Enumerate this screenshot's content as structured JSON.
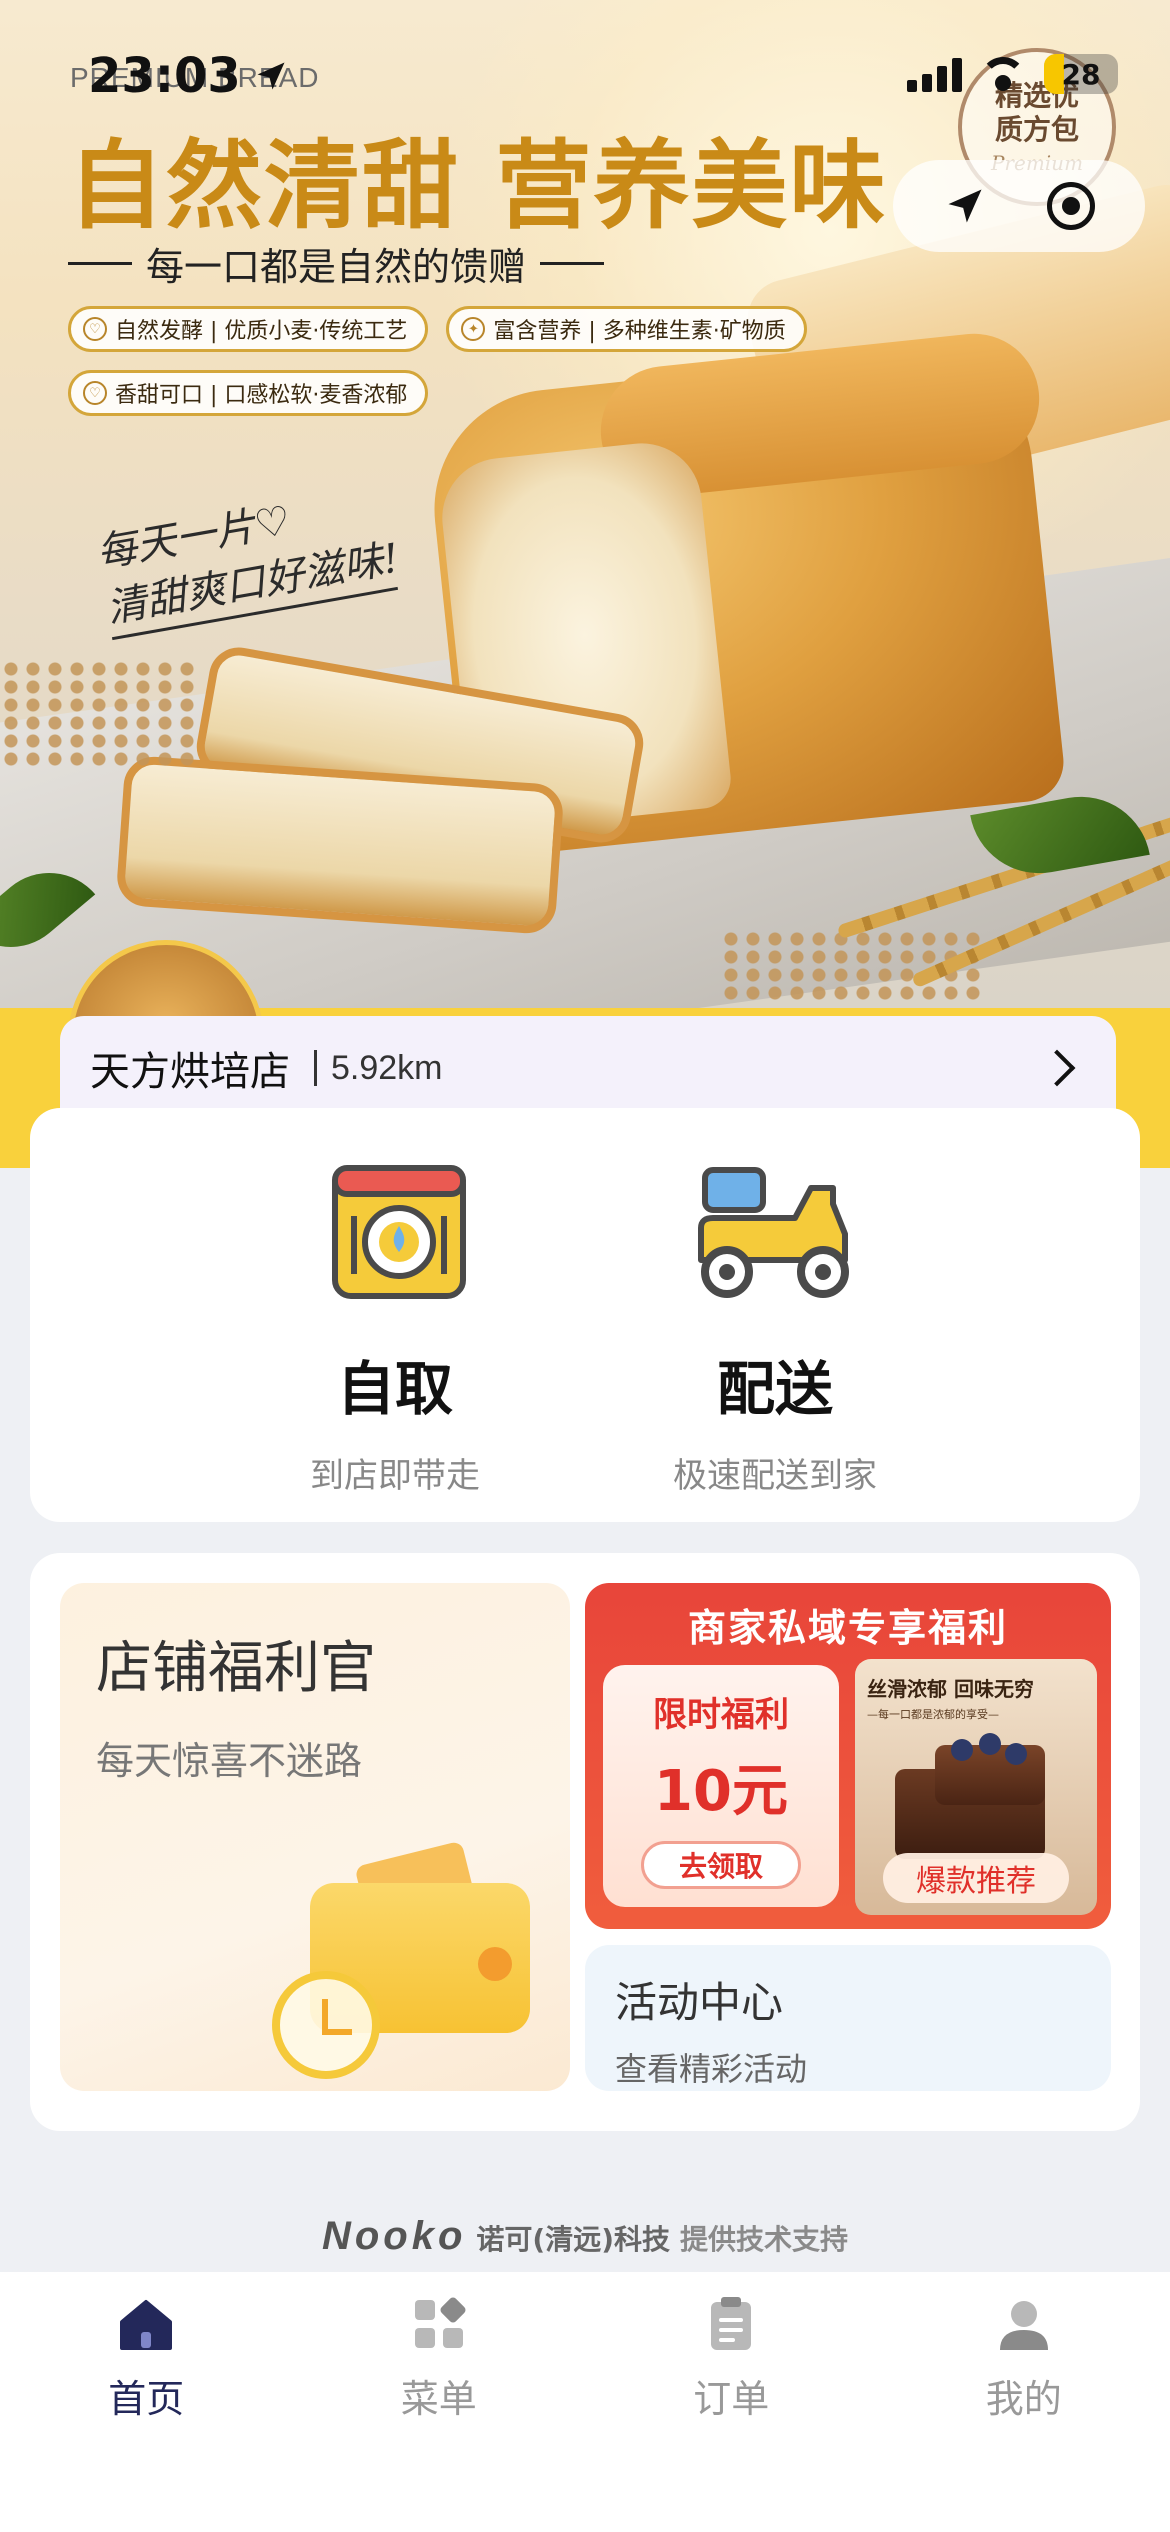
{
  "status_bar": {
    "time": "23:03",
    "battery": "28"
  },
  "banner": {
    "brand": "PREMIUM BREAD",
    "headline": "自然清甜 营养美味",
    "subline": "每一口都是自然的馈赠",
    "tags": [
      "自然发酵 | 优质小麦·传统工艺",
      "富含营养 | 多种维生素·矿物质",
      "香甜可口 | 口感松软·麦香浓郁"
    ],
    "handwriting_line1": "每天一片♡",
    "handwriting_line2": "清甜爽口好滋味!",
    "badge_text": "精选优质方包",
    "badge_sub": "Premium"
  },
  "store": {
    "name": "天方烘培店",
    "distance": "5.92km"
  },
  "modes": [
    {
      "title": "自取",
      "subtitle": "到店即带走",
      "icon": "dining-plate-icon"
    },
    {
      "title": "配送",
      "subtitle": "极速配送到家",
      "icon": "delivery-scooter-icon"
    }
  ],
  "promos": {
    "welfare_title": "店铺福利官",
    "welfare_sub": "每天惊喜不迷路",
    "merchant_title": "商家私域专享福利",
    "coupon_label": "限时福利",
    "coupon_amount": "10元",
    "coupon_button": "去领取",
    "poster_title": "丝滑浓郁 回味无穷",
    "poster_sub": "—每一口都是浓郁的享受—",
    "poster_badge": "爆款推荐",
    "activity_title": "活动中心",
    "activity_sub": "查看精彩活动"
  },
  "footer": {
    "brand": "Nooko",
    "company": "诺可(清远)科技",
    "support": "提供技术支持"
  },
  "tabs": [
    {
      "label": "首页",
      "icon": "home-icon",
      "active": true
    },
    {
      "label": "菜单",
      "icon": "menu-grid-icon",
      "active": false
    },
    {
      "label": "订单",
      "icon": "order-clipboard-icon",
      "active": false
    },
    {
      "label": "我的",
      "icon": "profile-icon",
      "active": false
    }
  ],
  "colors": {
    "accent": "#23285a",
    "banner_yellow": "#f9d13c",
    "headline_gold": "#c98a17",
    "promo_red": "#e8453a"
  }
}
